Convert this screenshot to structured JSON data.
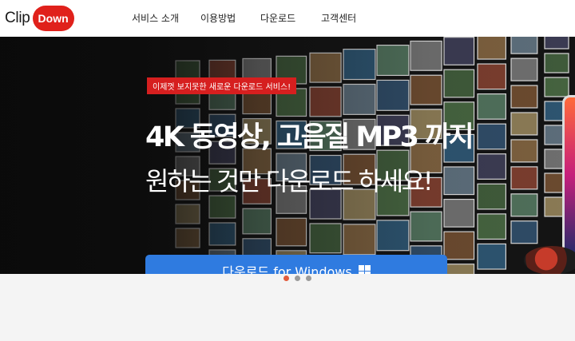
{
  "brand": {
    "name_part1": "Clip",
    "name_part2": "Down",
    "accent": "#e0211b"
  },
  "nav": {
    "items": [
      {
        "label": "서비스 소개"
      },
      {
        "label": "이용방법"
      },
      {
        "label": "다운로드"
      },
      {
        "label": "고객센터"
      }
    ]
  },
  "hero": {
    "badge": "이제껏 보지못한 새로운 다운로드 서비스!",
    "headline": "4K 동영상, 고음질 MP3 까지",
    "subheadline": "원하는 것만 다운로드 하세요!",
    "cta_label": "다운로드 for Windows",
    "cta_color": "#2f7be0",
    "cta_icon": "windows-icon",
    "badge_color": "#d61f1f"
  },
  "carousel": {
    "slides": 3,
    "active_index": 0
  }
}
